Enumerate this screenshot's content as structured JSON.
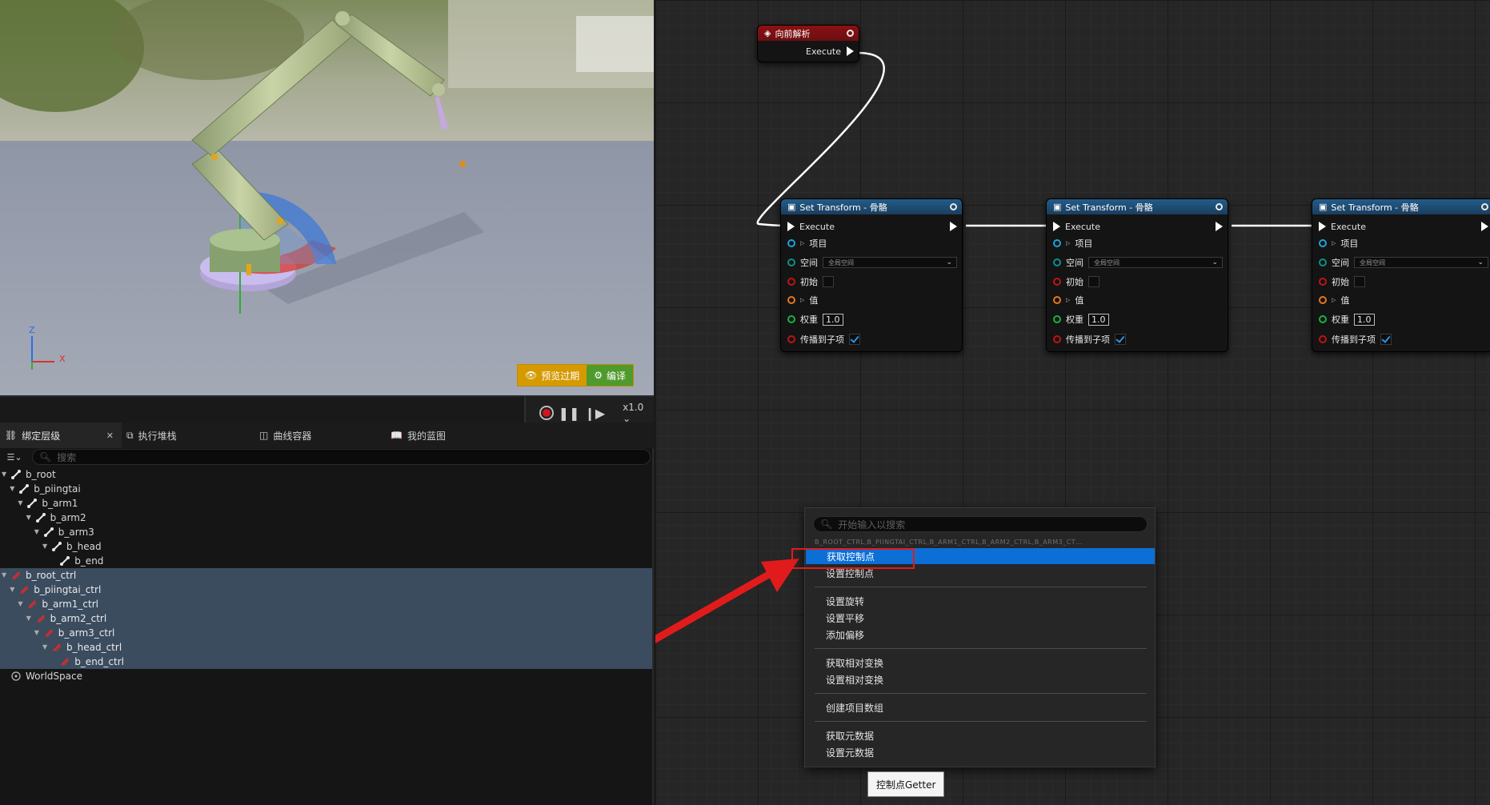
{
  "viewport": {
    "preview_label": "预览过期",
    "compile_label": "编译",
    "axis_z": "Z",
    "axis_x": "X"
  },
  "transport": {
    "speed": "x1.0"
  },
  "tabs": [
    {
      "label": "绑定层级",
      "icon": "hierarchy-icon"
    },
    {
      "label": "执行堆栈",
      "icon": "stack-icon"
    },
    {
      "label": "曲线容器",
      "icon": "curve-icon"
    },
    {
      "label": "我的蓝图",
      "icon": "book-icon"
    }
  ],
  "hierarchy": {
    "search_placeholder": "搜索",
    "items": [
      {
        "label": "b_root",
        "depth": 0,
        "type": "bone"
      },
      {
        "label": "b_piingtai",
        "depth": 1,
        "type": "bone"
      },
      {
        "label": "b_arm1",
        "depth": 2,
        "type": "bone"
      },
      {
        "label": "b_arm2",
        "depth": 3,
        "type": "bone"
      },
      {
        "label": "b_arm3",
        "depth": 4,
        "type": "bone"
      },
      {
        "label": "b_head",
        "depth": 5,
        "type": "bone"
      },
      {
        "label": "b_end",
        "depth": 6,
        "type": "bone"
      },
      {
        "label": "b_root_ctrl",
        "depth": 0,
        "type": "ctrl"
      },
      {
        "label": "b_piingtai_ctrl",
        "depth": 1,
        "type": "ctrl"
      },
      {
        "label": "b_arm1_ctrl",
        "depth": 2,
        "type": "ctrl"
      },
      {
        "label": "b_arm2_ctrl",
        "depth": 3,
        "type": "ctrl"
      },
      {
        "label": "b_arm3_ctrl",
        "depth": 4,
        "type": "ctrl"
      },
      {
        "label": "b_head_ctrl",
        "depth": 5,
        "type": "ctrl"
      },
      {
        "label": "b_end_ctrl",
        "depth": 6,
        "type": "ctrl"
      },
      {
        "label": "WorldSpace",
        "depth": 0,
        "type": "space"
      }
    ]
  },
  "graph": {
    "event_node": {
      "title": "向前解析",
      "pin": "Execute"
    },
    "set_transform_nodes": [
      {
        "title": "Set Transform - 骨骼"
      },
      {
        "title": "Set Transform - 骨骼"
      },
      {
        "title": "Set Transform - 骨骼"
      }
    ],
    "pins": {
      "execute": "Execute",
      "item": "项目",
      "space": "空间",
      "space_value": "全局空间",
      "initial": "初始",
      "value": "值",
      "weight": "权重",
      "weight_value": "1.0",
      "propagate": "传播到子项"
    }
  },
  "context_menu": {
    "search_placeholder": "开始输入以搜索",
    "context_path": "B_ROOT_CTRL,B_PIINGTAI_CTRL,B_ARM1_CTRL,B_ARM2_CTRL,B_ARM3_CT…",
    "groups": [
      [
        "获取控制点",
        "设置控制点"
      ],
      [
        "设置旋转",
        "设置平移",
        "添加偏移"
      ],
      [
        "获取相对变换",
        "设置相对变换"
      ],
      [
        "创建项目数组"
      ],
      [
        "获取元数据",
        "设置元数据"
      ]
    ],
    "highlighted": "获取控制点",
    "tooltip": "控制点Getter"
  },
  "colors": {
    "exec_wire": "#ffffff",
    "annotation_red": "#e11b1b",
    "highlight_blue": "#0b6fd6",
    "event_header": "#8c1111",
    "function_header": "#235c8a"
  }
}
